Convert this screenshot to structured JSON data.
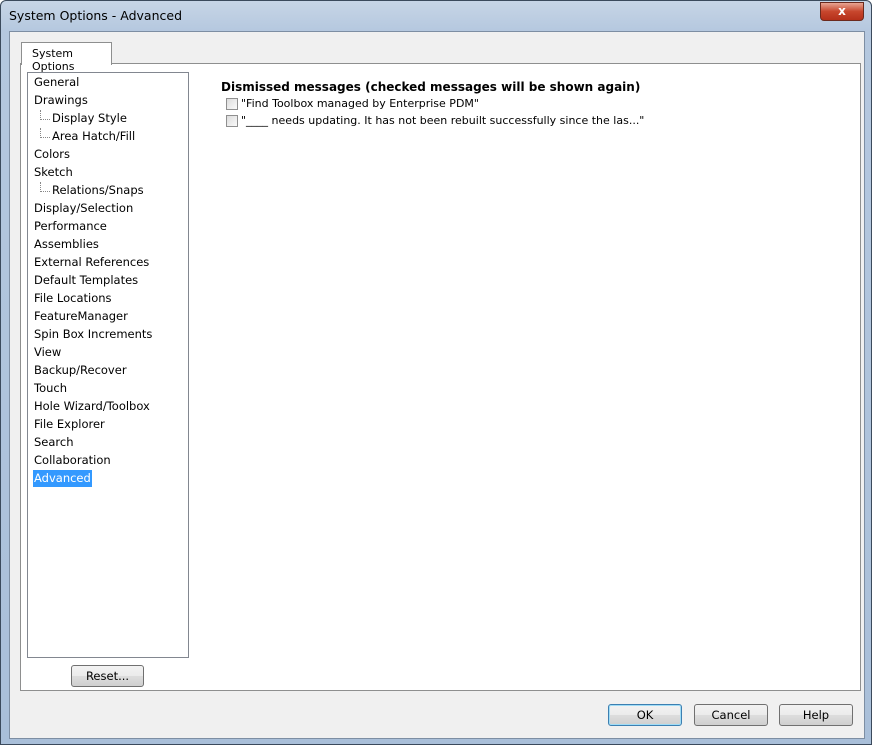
{
  "window": {
    "title": "System Options - Advanced",
    "close_label": "x"
  },
  "tab": {
    "label": "System Options"
  },
  "tree": [
    {
      "label": "General",
      "sub": false
    },
    {
      "label": "Drawings",
      "sub": false
    },
    {
      "label": "Display Style",
      "sub": true
    },
    {
      "label": "Area Hatch/Fill",
      "sub": true
    },
    {
      "label": "Colors",
      "sub": false
    },
    {
      "label": "Sketch",
      "sub": false
    },
    {
      "label": "Relations/Snaps",
      "sub": true
    },
    {
      "label": "Display/Selection",
      "sub": false
    },
    {
      "label": "Performance",
      "sub": false
    },
    {
      "label": "Assemblies",
      "sub": false
    },
    {
      "label": "External References",
      "sub": false
    },
    {
      "label": "Default Templates",
      "sub": false
    },
    {
      "label": "File Locations",
      "sub": false
    },
    {
      "label": "FeatureManager",
      "sub": false
    },
    {
      "label": "Spin Box Increments",
      "sub": false
    },
    {
      "label": "View",
      "sub": false
    },
    {
      "label": "Backup/Recover",
      "sub": false
    },
    {
      "label": "Touch",
      "sub": false
    },
    {
      "label": "Hole Wizard/Toolbox",
      "sub": false
    },
    {
      "label": "File Explorer",
      "sub": false
    },
    {
      "label": "Search",
      "sub": false
    },
    {
      "label": "Collaboration",
      "sub": false
    },
    {
      "label": "Advanced",
      "sub": false,
      "selected": true
    }
  ],
  "reset_label": "Reset...",
  "content": {
    "heading": "Dismissed messages (checked messages will be shown again)",
    "messages": [
      {
        "label": "\"Find Toolbox managed by Enterprise PDM\"",
        "checked": false
      },
      {
        "label": "\"____ needs updating.  It has not been rebuilt successfully since the las...\"",
        "checked": false
      }
    ]
  },
  "buttons": {
    "ok": "OK",
    "cancel": "Cancel",
    "help": "Help"
  }
}
